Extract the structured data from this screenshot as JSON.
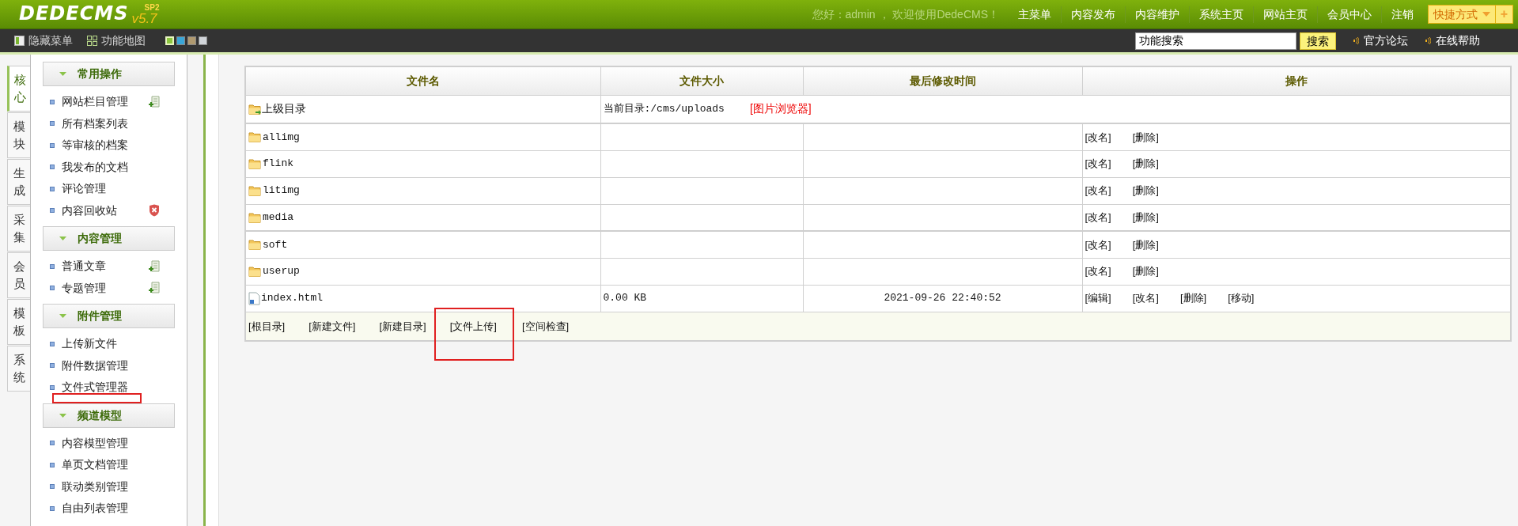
{
  "header": {
    "logo": "DEDECMS",
    "version": "v5.7",
    "edition": "SP2",
    "greeting": "您好：admin ， 欢迎使用DedeCMS！",
    "nav": [
      "主菜单",
      "内容发布",
      "内容维护",
      "系统主页",
      "网站主页",
      "会员中心",
      "注销"
    ],
    "shortcut": "快捷方式",
    "shortcut_add": "+"
  },
  "toolbar": {
    "items": [
      {
        "label": "隐藏菜单",
        "kind": "hide"
      },
      {
        "label": "功能地图",
        "kind": "map"
      }
    ],
    "skins": [
      {
        "color": "#8cc63f",
        "selected": true
      },
      {
        "color": "#3aa6d8",
        "selected": false
      },
      {
        "color": "#b09a70",
        "selected": false
      },
      {
        "color": "#d0d4d8",
        "selected": false
      }
    ],
    "search": {
      "value": "功能搜索"
    },
    "search_button": "搜索",
    "links": [
      "官方论坛",
      "在线帮助"
    ]
  },
  "side_tabs": [
    {
      "label": "核心",
      "selected": true
    },
    {
      "label": "模块",
      "selected": false
    },
    {
      "label": "生成",
      "selected": false
    },
    {
      "label": "采集",
      "selected": false
    },
    {
      "label": "会员",
      "selected": false
    },
    {
      "label": "模板",
      "selected": false
    },
    {
      "label": "系统",
      "selected": false
    }
  ],
  "menu": [
    {
      "title": "常用操作",
      "items": [
        {
          "label": "网站栏目管理",
          "kind": "add",
          "marked": false
        },
        {
          "label": "所有档案列表",
          "marked": false
        },
        {
          "label": "等审核的档案",
          "marked": false
        },
        {
          "label": "我发布的文档",
          "marked": false
        },
        {
          "label": "评论管理",
          "marked": false
        },
        {
          "label": "内容回收站",
          "kind": "delete",
          "marked": false
        }
      ]
    },
    {
      "title": "内容管理",
      "items": [
        {
          "label": "普通文章",
          "kind": "add",
          "marked": false
        },
        {
          "label": "专题管理",
          "kind": "add",
          "marked": false
        }
      ]
    },
    {
      "title": "附件管理",
      "items": [
        {
          "label": "上传新文件",
          "marked": false
        },
        {
          "label": "附件数据管理",
          "marked": false
        },
        {
          "label": "文件式管理器",
          "marked": true
        }
      ]
    },
    {
      "title": "频道模型",
      "items": [
        {
          "label": "内容模型管理",
          "marked": false
        },
        {
          "label": "单页文档管理",
          "marked": false
        },
        {
          "label": "联动类别管理",
          "marked": false
        },
        {
          "label": "自由列表管理",
          "marked": false
        }
      ]
    }
  ],
  "table": {
    "columns": [
      "文件名",
      "文件大小",
      "最后修改时间",
      "操作"
    ],
    "parent": {
      "name": "上级目录",
      "current_dir": "当前目录:/cms/uploads",
      "browser_link": "[图片浏览器]"
    },
    "rows": [
      {
        "kind": "folder",
        "name": "allimg",
        "actions": [
          "[改名]",
          "[删除]"
        ]
      },
      {
        "kind": "folder",
        "name": "flink",
        "actions": [
          "[改名]",
          "[删除]"
        ]
      },
      {
        "kind": "folder",
        "name": "litimg",
        "actions": [
          "[改名]",
          "[删除]"
        ]
      },
      {
        "kind": "folder",
        "name": "media",
        "actions": [
          "[改名]",
          "[删除]"
        ]
      },
      {
        "kind": "folder",
        "name": "soft",
        "actions": [
          "[改名]",
          "[删除]"
        ]
      },
      {
        "kind": "folder",
        "name": "userup",
        "actions": [
          "[改名]",
          "[删除]"
        ]
      },
      {
        "kind": "file",
        "name": "index.html",
        "size": "0.00 KB",
        "modified": "2021-09-26 22:40:52",
        "actions": [
          "[编辑]",
          "[改名]",
          "[删除]",
          "[移动]"
        ]
      }
    ],
    "footer_links": [
      {
        "label": "[根目录]",
        "marked": false
      },
      {
        "label": "[新建文件]",
        "marked": false
      },
      {
        "label": "[新建目录]",
        "marked": false
      },
      {
        "label": "[文件上传]",
        "marked": true
      },
      {
        "label": "[空间检查]",
        "marked": false
      }
    ]
  }
}
